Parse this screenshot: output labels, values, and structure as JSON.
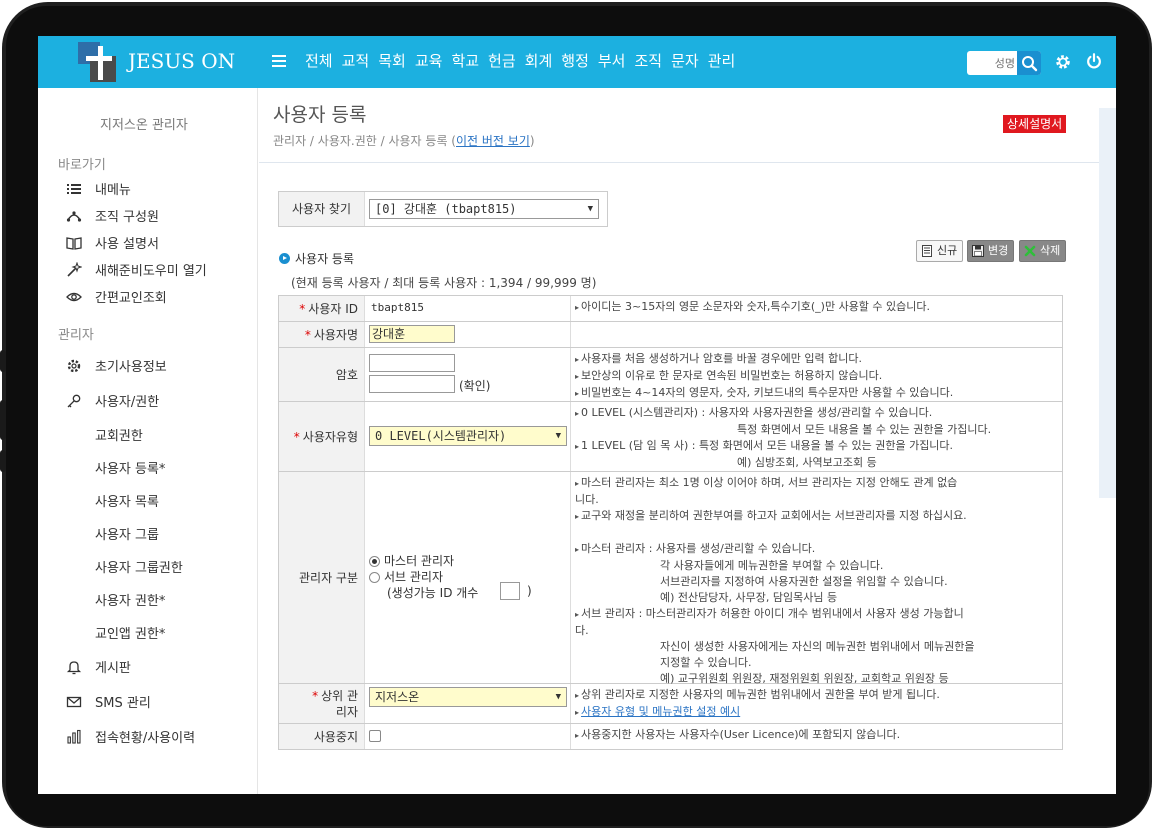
{
  "header": {
    "brand": "JESUS ON",
    "nav": [
      "전체",
      "교적",
      "목회",
      "교육",
      "학교",
      "헌금",
      "회계",
      "행정",
      "부서",
      "조직",
      "문자",
      "관리"
    ],
    "search_placeholder": "성명"
  },
  "sidebar": {
    "title": "지저스온 관리자",
    "section_shortcuts": "바로가기",
    "shortcuts": [
      {
        "label": "내메뉴",
        "icon": "list-icon"
      },
      {
        "label": "조직 구성원",
        "icon": "org-icon"
      },
      {
        "label": "사용 설명서",
        "icon": "book-icon"
      },
      {
        "label": "새해준비도우미 열기",
        "icon": "wand-icon"
      },
      {
        "label": "간편교인조회",
        "icon": "eye-icon"
      }
    ],
    "section_admin": "관리자",
    "admin_items": {
      "initial_info": "초기사용정보",
      "user_rights": "사용자/권한",
      "sub": [
        "교회권한",
        "사용자 등록*",
        "사용자 목록",
        "사용자 그룹",
        "사용자 그룹권한",
        "사용자 권한*",
        "교인앱 권한*"
      ],
      "board": "게시판",
      "sms": "SMS 관리",
      "access": "접속현황/사용이력"
    }
  },
  "page": {
    "title": "사용자 등록",
    "breadcrumb": "관리자 / 사용자.권한 / 사용자 등록 (",
    "prev_version_link": "이전 버전 보기",
    "breadcrumb_close": ")",
    "manual_button": "상세설명서"
  },
  "finder": {
    "label": "사용자 찾기",
    "selected": "[0] 강대훈 (tbapt815)"
  },
  "registration": {
    "heading": "사용자 등록",
    "count_text": "(현재 등록 사용자 / 최대 등록 사용자 : 1,394 / 99,999 명)",
    "buttons": {
      "new": "신규",
      "edit": "변경",
      "delete": "삭제"
    }
  },
  "form": {
    "user_id": {
      "label": "사용자 ID",
      "value": "tbapt815",
      "desc": [
        "아이디는 3~15자의 영문 소문자와 숫자,특수기호(_)만 사용할 수 있습니다."
      ]
    },
    "user_name": {
      "label": "사용자명",
      "value": "강대훈"
    },
    "password": {
      "label": "암호",
      "confirm": "(확인)",
      "desc": [
        "사용자를 처음 생성하거나 암호를 바꿀 경우에만 입력 합니다.",
        "보안상의 이유로 한 문자로 연속된 비밀번호는 허용하지 않습니다.",
        "비밀번호는 4~14자의 영문자, 숫자, 키보드내의 특수문자만 사용할 수 있습니다."
      ]
    },
    "user_type": {
      "label": "사용자유형",
      "selected": "0 LEVEL(시스템관리자)",
      "desc": [
        "0 LEVEL (시스템관리자) : 사용자와 사용자권한을 생성/관리할 수 있습니다.",
        "특정 화면에서 모든 내용을 볼 수 있는 권한을 가집니다.",
        "1 LEVEL (담  임  목 사) : 특정 화면에서 모든 내용을 볼 수 있는 권한을 가집니다.",
        "예) 심방조회, 사역보고조회 등"
      ]
    },
    "admin_type": {
      "label": "관리자 구분",
      "master": "마스터 관리자",
      "sub": "서브 관리자",
      "count_label": "(생성가능 ID 개수",
      "count_close": ")",
      "desc": [
        "마스터 관리자는 최소 1명 이상 이어야 하며, 서브 관리자는 지정 안해도 관계 없습",
        "니다.",
        "교구와 재정을 분리하여 권한부여를 하고자 교회에서는 서브관리자를 지정 하십시요.",
        "마스터 관리자 : 사용자를 생성/관리할 수 있습니다.",
        "각 사용자들에게 메뉴권한을 부여할 수 있습니다.",
        "서브관리자를 지정하여 사용자권한 설정을 위임할 수 있습니다.",
        "예) 전산담당자, 사무장, 담임목사님 등",
        "서브 관리자 : 마스터관리자가 허용한 아이디 개수 범위내에서 사용자 생성 가능합니",
        "다.",
        "자신이 생성한 사용자에게는 자신의 메뉴권한 범위내에서 메뉴권한을",
        "지정할 수 있습니다.",
        "예) 교구위원회 위원장, 재정위원회 위원장, 교회학교 위원장 등"
      ]
    },
    "parent_admin": {
      "label": "상위 관리자",
      "selected": "지저스온",
      "desc": [
        "상위 관리자로 지정한 사용자의 메뉴권한 범위내에서 권한을 부여 받게 됩니다."
      ],
      "link": "사용자 유형 및 메뉴권한 설정 예시"
    },
    "suspend": {
      "label": "사용중지",
      "desc": [
        "사용중지한 사용자는 사용자수(User Licence)에 포함되지 않습니다."
      ]
    }
  },
  "colors": {
    "topbar": "#1cb0e0",
    "required": "#dd0000",
    "manual": "#e0181f",
    "link": "#2b74c4"
  }
}
